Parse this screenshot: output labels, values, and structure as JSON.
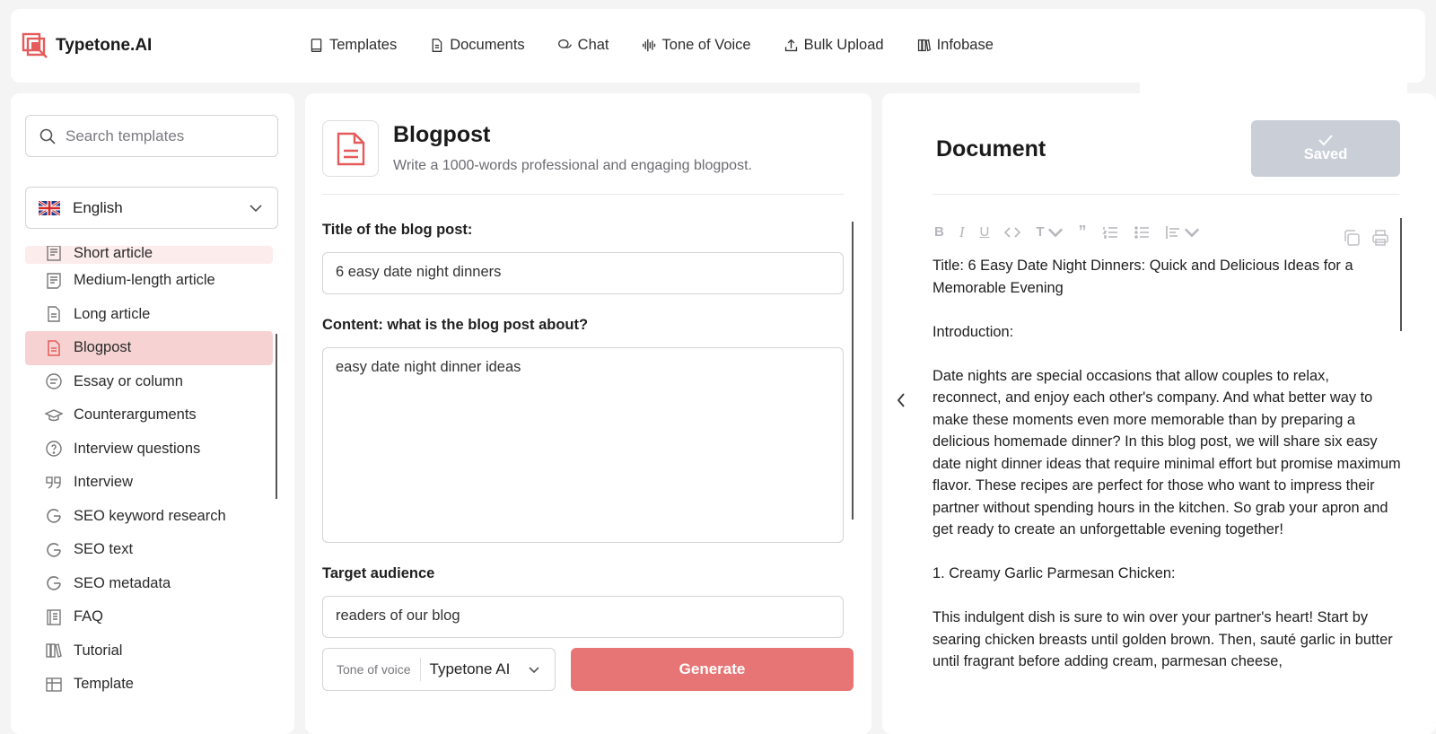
{
  "app": {
    "name": "Typetone.AI",
    "brand_color": "#e55a5a"
  },
  "nav": [
    {
      "label": "Templates",
      "icon": "book-icon"
    },
    {
      "label": "Documents",
      "icon": "document-icon"
    },
    {
      "label": "Chat",
      "icon": "chat-icon"
    },
    {
      "label": "Tone of Voice",
      "icon": "soundwave-icon"
    },
    {
      "label": "Bulk Upload",
      "icon": "upload-icon"
    },
    {
      "label": "Infobase",
      "icon": "library-icon"
    }
  ],
  "sidebar": {
    "search_placeholder": "Search templates",
    "language": "English",
    "items": [
      {
        "label": "Short article",
        "icon": "article-icon"
      },
      {
        "label": "Medium-length article",
        "icon": "article-icon"
      },
      {
        "label": "Long article",
        "icon": "file-icon"
      },
      {
        "label": "Blogpost",
        "icon": "blog-icon"
      },
      {
        "label": "Essay or column",
        "icon": "essay-icon"
      },
      {
        "label": "Counterarguments",
        "icon": "graduation-cap-icon"
      },
      {
        "label": "Interview questions",
        "icon": "question-icon"
      },
      {
        "label": "Interview",
        "icon": "quote-icon"
      },
      {
        "label": "SEO keyword research",
        "icon": "google-icon"
      },
      {
        "label": "SEO text",
        "icon": "google-icon"
      },
      {
        "label": "SEO metadata",
        "icon": "google-icon"
      },
      {
        "label": "FAQ",
        "icon": "faq-icon"
      },
      {
        "label": "Tutorial",
        "icon": "library-icon"
      },
      {
        "label": "Template",
        "icon": "table-icon"
      }
    ],
    "active_item": "Blogpost"
  },
  "template": {
    "title": "Blogpost",
    "subtitle": "Write a 1000-words professional and engaging blogpost.",
    "fields": [
      {
        "label": "Title of the blog post:",
        "value": "6 easy date night dinners"
      },
      {
        "label": "Content: what is the blog post about?",
        "value": "easy date night dinner ideas"
      },
      {
        "label": "Target audience",
        "value": "readers of our blog"
      }
    ],
    "tone_label": "Tone of voice",
    "tone_value": "Typetone AI",
    "generate_label": "Generate"
  },
  "document": {
    "title": "Document",
    "saved_label": "Saved",
    "paragraphs": [
      "Title: 6 Easy Date Night Dinners: Quick and Delicious Ideas for a Memorable Evening",
      "Introduction:",
      "Date nights are special occasions that allow couples to relax, reconnect, and enjoy each other's company. And what better way to make these moments even more memorable than by preparing a delicious homemade dinner? In this blog post, we will share six easy date night dinner ideas that require minimal effort but promise maximum flavor. These recipes are perfect for those who want to impress their partner without spending hours in the kitchen. So grab your apron and get ready to create an unforgettable evening together!",
      "1. Creamy Garlic Parmesan Chicken:",
      "This indulgent dish is sure to win over your partner's heart! Start by searing chicken breasts until golden brown. Then, sauté garlic in butter until fragrant before adding cream, parmesan cheese,"
    ]
  }
}
